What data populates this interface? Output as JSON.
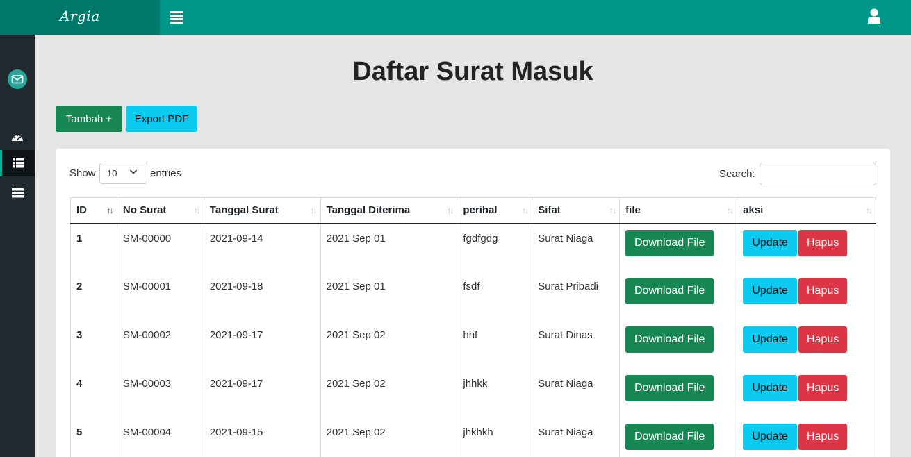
{
  "app": {
    "brand": "Argia"
  },
  "page": {
    "title": "Daftar Surat Masuk"
  },
  "toolbar": {
    "add_label": "Tambah +",
    "export_label": "Export PDF"
  },
  "table_controls": {
    "show_label": "Show",
    "length_value": "10",
    "entries_label": "entries",
    "search_label": "Search:",
    "search_value": ""
  },
  "table": {
    "headers": [
      "ID",
      "No Surat",
      "Tanggal Surat",
      "Tanggal Diterima",
      "perihal",
      "Sifat",
      "file",
      "aksi"
    ],
    "rows": [
      {
        "id": "1",
        "no": "SM-00000",
        "tgl_surat": "2021-09-14",
        "tgl_diterima": "2021 Sep 01",
        "perihal": "fgdfgdg",
        "sifat": "Surat Niaga"
      },
      {
        "id": "2",
        "no": "SM-00001",
        "tgl_surat": "2021-09-18",
        "tgl_diterima": "2021 Sep 01",
        "perihal": "fsdf",
        "sifat": "Surat Pribadi"
      },
      {
        "id": "3",
        "no": "SM-00002",
        "tgl_surat": "2021-09-17",
        "tgl_diterima": "2021 Sep 02",
        "perihal": "hhf",
        "sifat": "Surat Dinas"
      },
      {
        "id": "4",
        "no": "SM-00003",
        "tgl_surat": "2021-09-17",
        "tgl_diterima": "2021 Sep 02",
        "perihal": "jhhkk",
        "sifat": "Surat Niaga"
      },
      {
        "id": "5",
        "no": "SM-00004",
        "tgl_surat": "2021-09-15",
        "tgl_diterima": "2021 Sep 02",
        "perihal": "jhkhkh",
        "sifat": "Surat Niaga"
      }
    ],
    "row_actions": {
      "download_label": "Download File",
      "update_label": "Update",
      "delete_label": "Hapus"
    }
  },
  "icons": {
    "menu": "hamburger-icon",
    "user": "user-icon",
    "mail": "mail-icon",
    "dashboard": "dashboard-icon",
    "list": "list-icon"
  },
  "colors": {
    "topbar": "#009688",
    "brand_bg": "#00796b",
    "sidebar": "#212b2f",
    "success": "#198754",
    "info": "#0dcaf0",
    "danger": "#dc3545"
  }
}
